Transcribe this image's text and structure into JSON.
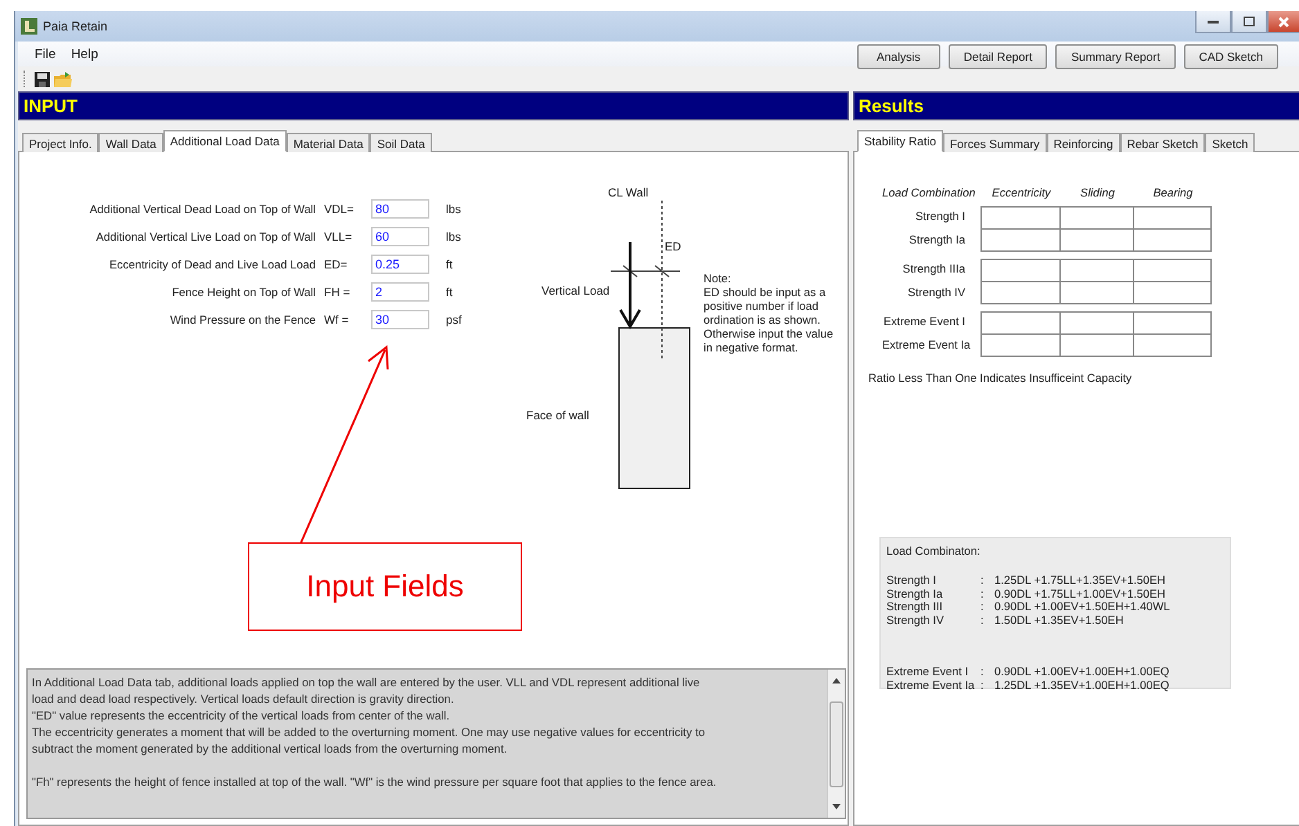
{
  "window": {
    "title": "Paia Retain"
  },
  "menu": [
    "File",
    "Help"
  ],
  "action_buttons": [
    "Analysis",
    "Detail Report",
    "Summary Report",
    "CAD Sketch"
  ],
  "input_panel": {
    "header": "INPUT",
    "tabs": [
      {
        "label": "Project Info.",
        "selected": false
      },
      {
        "label": "Wall Data",
        "selected": false
      },
      {
        "label": "Additional Load Data",
        "selected": true
      },
      {
        "label": "Material Data",
        "selected": false
      },
      {
        "label": "Soil Data",
        "selected": false
      }
    ],
    "fields": [
      {
        "label": "Additional Vertical Dead Load on Top of  Wall",
        "code": "VDL=",
        "value": "80",
        "unit": "lbs"
      },
      {
        "label": "Additional Vertical Live Load on Top of  Wall",
        "code": "VLL=",
        "value": "60",
        "unit": "lbs"
      },
      {
        "label": "Eccentricity of Dead and Live Load Load",
        "code": "ED=",
        "value": "0.25",
        "unit": "ft"
      },
      {
        "label": "Fence Height on Top of Wall",
        "code": "FH =",
        "value": "2",
        "unit": "ft"
      },
      {
        "label": "Wind Pressure on the Fence",
        "code": "Wf =",
        "value": "30",
        "unit": "psf"
      }
    ],
    "diagram": {
      "cl_label": "CL Wall",
      "ed_label": "ED",
      "load_label": "Vertical Load",
      "face_label": "Face of wall",
      "note": [
        "Note:",
        "ED should be input as a",
        "positive number if load",
        "ordination is as shown.",
        "Otherwise input the value",
        "in negative format."
      ]
    },
    "help_text": [
      [
        "In Additional Load Data tab, additional loads applied on top the wall are entered by the user. VLL and VDL represent additional live",
        "load and dead load respectively.  Vertical loads default direction is gravity direction.",
        "\"ED\" value represents the eccentricity of the vertical loads from center of the wall.",
        "The eccentricity generates a moment that will be added to the overturning moment. One may use negative values for eccentricity to",
        "subtract the moment generated by the additional vertical loads from the overturning moment."
      ],
      [
        "\"Fh\" represents the height of fence installed at top of the wall.  \"Wf\" is the wind pressure per square foot that applies to the fence area."
      ]
    ]
  },
  "annotation": {
    "text": "Input Fields"
  },
  "results_panel": {
    "header": "Results",
    "tabs": [
      {
        "label": "Stability Ratio",
        "selected": true
      },
      {
        "label": "Forces Summary",
        "selected": false
      },
      {
        "label": "Reinforcing",
        "selected": false
      },
      {
        "label": "Rebar Sketch",
        "selected": false
      },
      {
        "label": "Sketch",
        "selected": false
      }
    ],
    "table": {
      "columns": [
        "Load Combination",
        "Eccentricity",
        "Sliding",
        "Bearing"
      ],
      "groups": [
        [
          "Strength I",
          "Strength Ia"
        ],
        [
          "Strength IIIa",
          "Strength IV"
        ],
        [
          "Extreme Event I",
          "Extreme Event Ia"
        ]
      ]
    },
    "footnote": "Ratio Less Than One Indicates Insufficeint Capacity",
    "load_combination": {
      "title": "Load Combinaton:",
      "groups": [
        [
          {
            "name": "Strength I",
            "sep": ":",
            "formula": "1.25DL +1.75LL+1.35EV+1.50EH"
          },
          {
            "name": "Strength Ia",
            "sep": ":",
            "formula": "0.90DL +1.75LL+1.00EV+1.50EH"
          },
          {
            "name": "Strength III",
            "sep": ":",
            "formula": "0.90DL +1.00EV+1.50EH+1.40WL"
          },
          {
            "name": "Strength IV",
            "sep": ":",
            "formula": "1.50DL +1.35EV+1.50EH"
          }
        ],
        [
          {
            "name": "Extreme Event  I",
            "sep": ":",
            "formula": "0.90DL +1.00EV+1.00EH+1.00EQ"
          },
          {
            "name": "Extreme Event  Ia",
            "sep": ":",
            "formula": "1.25DL +1.35EV+1.00EH+1.00EQ"
          }
        ]
      ]
    }
  }
}
